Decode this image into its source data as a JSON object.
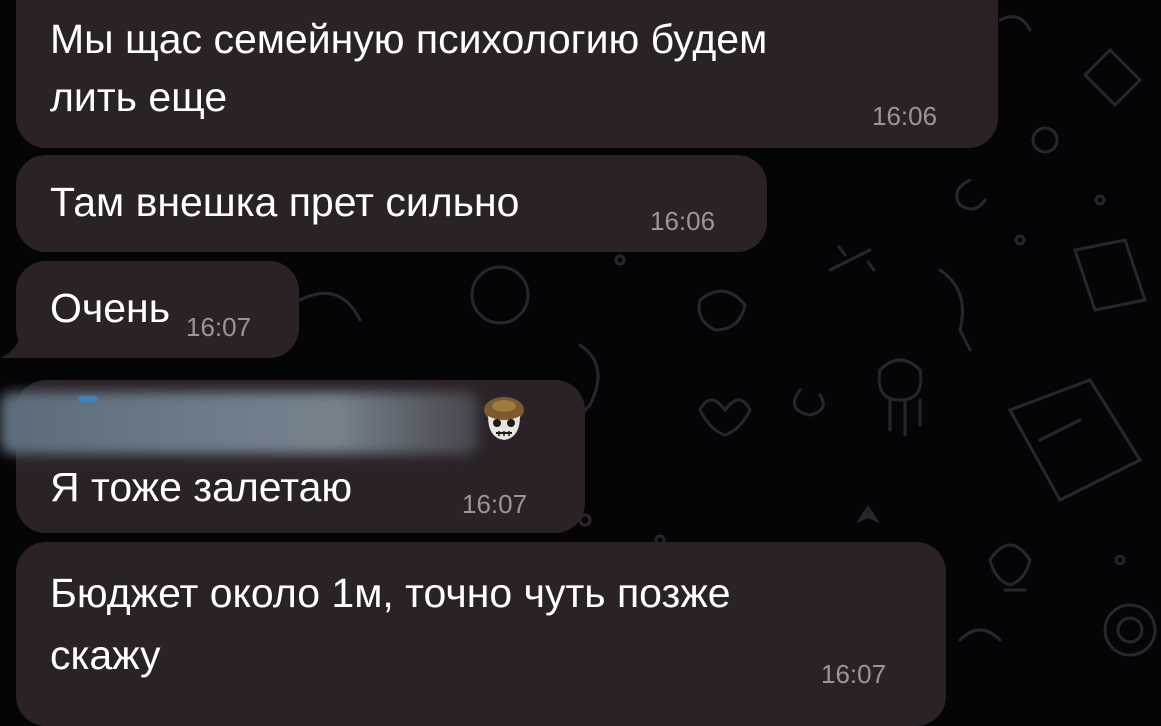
{
  "messages": [
    {
      "text_lines": [
        "Мы щас семейную психологию будем",
        "лить еще"
      ],
      "time": "16:06"
    },
    {
      "text_lines": [
        "Там внешка прет сильно"
      ],
      "time": "16:06"
    },
    {
      "text_lines": [
        "Очень"
      ],
      "time": "16:07"
    },
    {
      "text_lines": [
        "Я тоже залетаю"
      ],
      "time": "16:07"
    },
    {
      "text_lines": [
        "Бюджет около 1м, точно чуть позже",
        "скажу"
      ],
      "time": "16:07"
    }
  ],
  "icons": [
    "chat-wallpaper-doodles",
    "sender-sticker-badge-icon"
  ],
  "colors": {
    "background": "#050406",
    "bubble": "#2b2228",
    "text": "#ffffff",
    "time": "#9d9399"
  }
}
